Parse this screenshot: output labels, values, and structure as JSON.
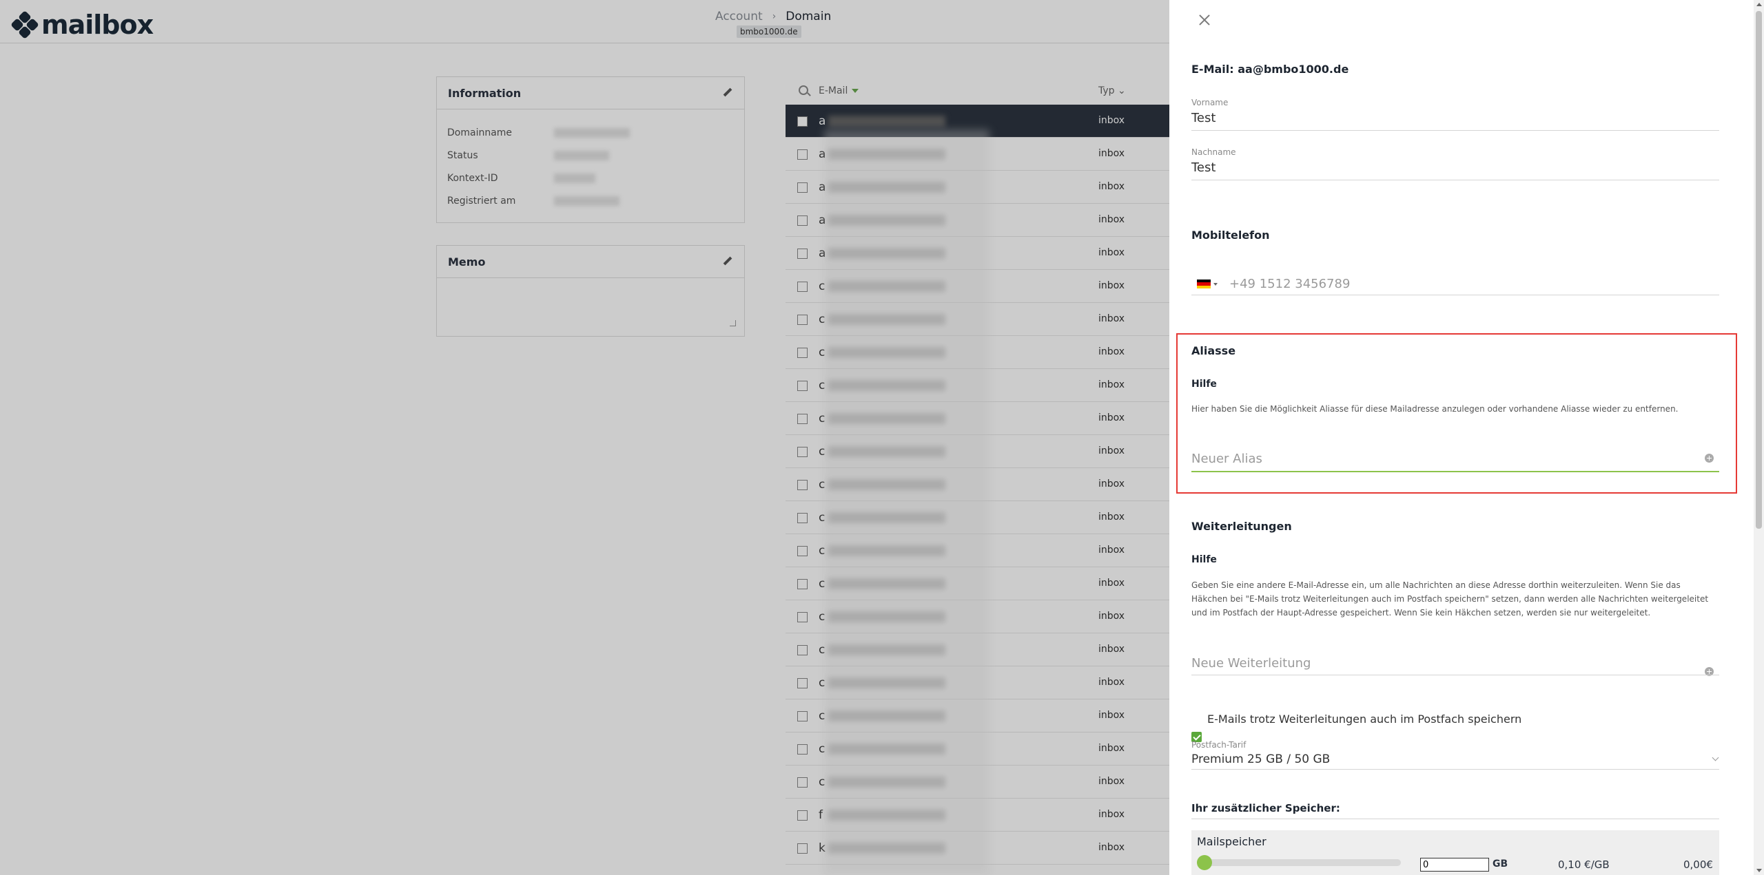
{
  "header": {
    "logo_text": "mailbox",
    "breadcrumb": {
      "account": "Account",
      "separator": "›",
      "domain": "Domain"
    },
    "domain_badge": "bmbo1000.de"
  },
  "info_card": {
    "title": "Information",
    "rows": [
      {
        "label": "Domainname"
      },
      {
        "label": "Status"
      },
      {
        "label": "Kontext-ID"
      },
      {
        "label": "Registriert am"
      }
    ]
  },
  "memo_card": {
    "title": "Memo"
  },
  "mail_list": {
    "col_email": "E-Mail",
    "col_typ": "Typ ⌄",
    "rows": [
      {
        "prefix": "a",
        "typ": "inbox",
        "selected": true
      },
      {
        "prefix": "a",
        "typ": "inbox"
      },
      {
        "prefix": "a",
        "typ": "inbox"
      },
      {
        "prefix": "a",
        "typ": "inbox"
      },
      {
        "prefix": "a",
        "typ": "inbox"
      },
      {
        "prefix": "c",
        "typ": "inbox"
      },
      {
        "prefix": "c",
        "typ": "inbox"
      },
      {
        "prefix": "c",
        "typ": "inbox"
      },
      {
        "prefix": "c",
        "typ": "inbox"
      },
      {
        "prefix": "c",
        "typ": "inbox"
      },
      {
        "prefix": "c",
        "typ": "inbox"
      },
      {
        "prefix": "c",
        "typ": "inbox"
      },
      {
        "prefix": "c",
        "typ": "inbox"
      },
      {
        "prefix": "c",
        "typ": "inbox"
      },
      {
        "prefix": "c",
        "typ": "inbox"
      },
      {
        "prefix": "c",
        "typ": "inbox"
      },
      {
        "prefix": "c",
        "typ": "inbox"
      },
      {
        "prefix": "c",
        "typ": "inbox"
      },
      {
        "prefix": "c",
        "typ": "inbox"
      },
      {
        "prefix": "c",
        "typ": "inbox"
      },
      {
        "prefix": "c",
        "typ": "inbox"
      },
      {
        "prefix": "f",
        "typ": "inbox"
      },
      {
        "prefix": "k",
        "typ": "inbox"
      }
    ]
  },
  "panel": {
    "title": "E-Mail: aa@bmbo1000.de",
    "vorname": {
      "label": "Vorname",
      "value": "Test"
    },
    "nachname": {
      "label": "Nachname",
      "value": "Test"
    },
    "mobil": {
      "title": "Mobiltelefon",
      "placeholder": "+49 1512 3456789"
    },
    "aliasse": {
      "title": "Aliasse",
      "hilfe": "Hilfe",
      "help_text": "Hier haben Sie die Möglichkeit Aliasse für diese Mailadresse anzulegen oder vorhandene Aliasse wieder zu entfernen.",
      "placeholder": "Neuer Alias"
    },
    "weiterleitungen": {
      "title": "Weiterleitungen",
      "hilfe": "Hilfe",
      "help_text": "Geben Sie eine andere E-Mail-Adresse ein, um alle Nachrichten an diese Adresse dorthin weiterzuleiten. Wenn Sie das Häkchen bei \"E-Mails trotz Weiterleitungen auch im Postfach speichern\" setzen, dann werden alle Nachrichten weitergeleitet und im Postfach der Haupt-Adresse gespeichert. Wenn Sie kein Häkchen setzen, werden sie nur weitergeleitet.",
      "placeholder": "Neue Weiterleitung"
    },
    "keep_copy_label": "E-Mails trotz Weiterleitungen auch im Postfach speichern",
    "tarif": {
      "label": "Postfach-Tarif",
      "value": "Premium 25 GB / 50 GB"
    },
    "storage": {
      "title": "Ihr zusätzlicher Speicher:",
      "mail_label": "Mailspeicher",
      "gb_value": "0",
      "unit": "GB",
      "price": "0,10 €/GB",
      "total": "0,00€"
    }
  },
  "colors": {
    "accent_green": "#5aa83a",
    "highlight_red": "#e53935",
    "selected_row": "#2c3440"
  }
}
